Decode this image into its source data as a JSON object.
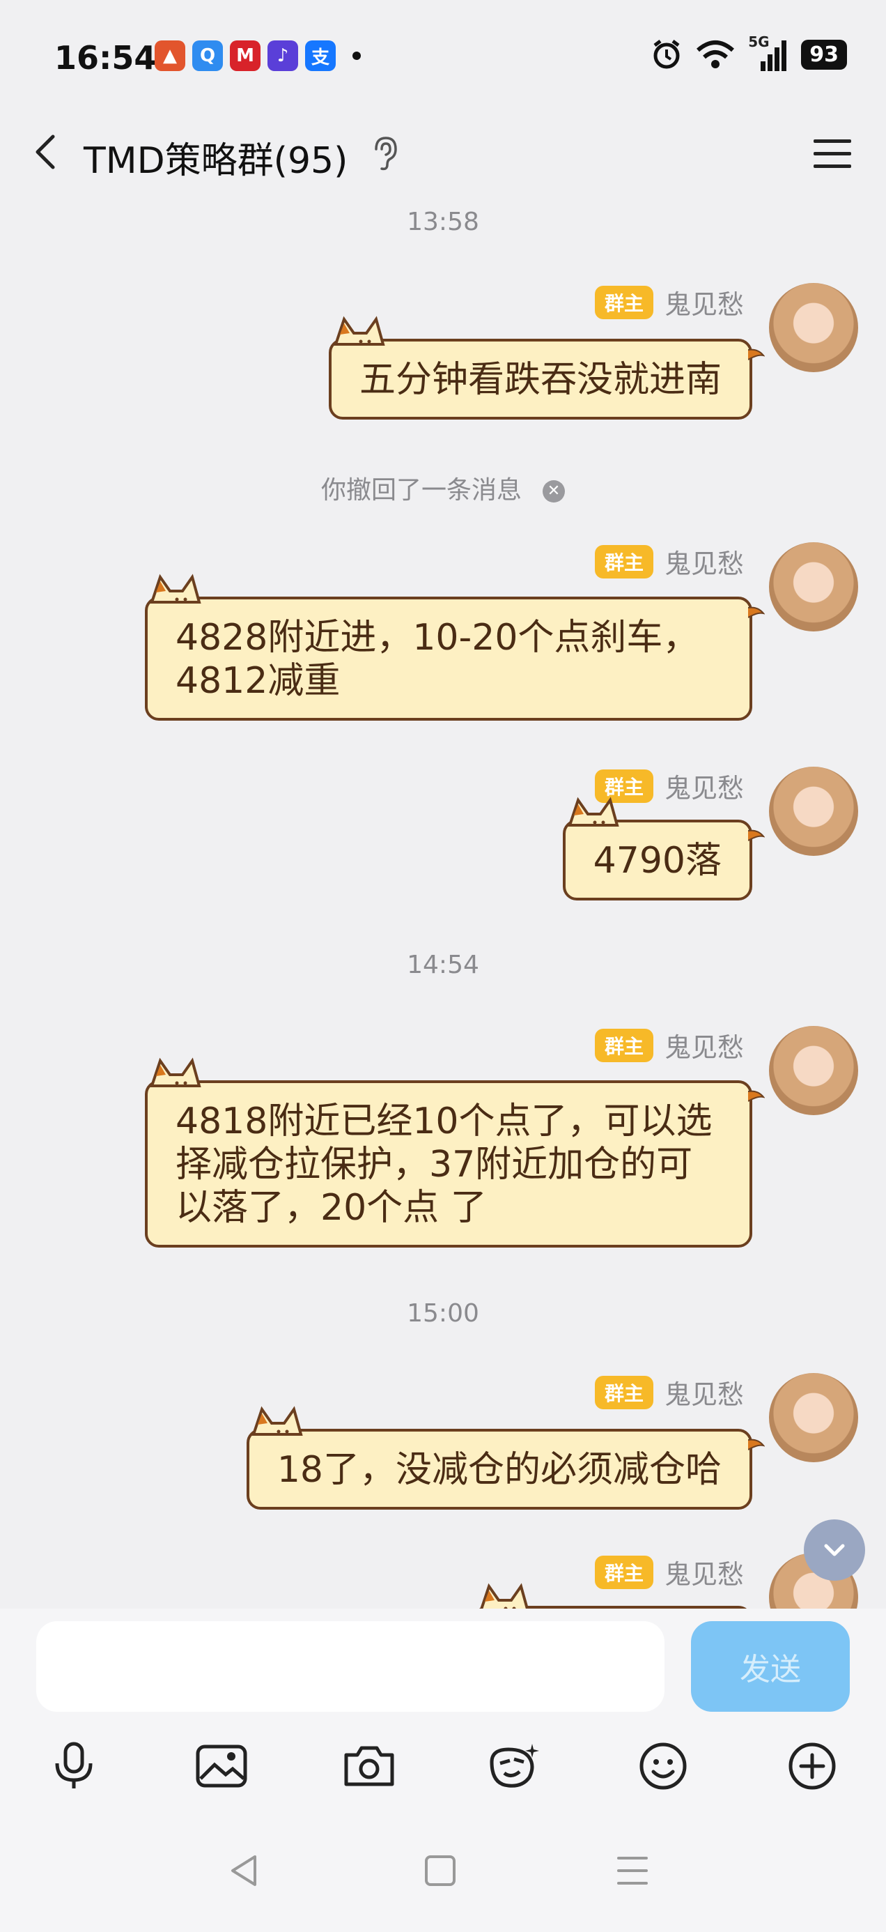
{
  "status_bar": {
    "time": "16:54",
    "app_icons": [
      {
        "name": "meituan-app-icon",
        "color": "#e2552d",
        "glyph": "🎪"
      },
      {
        "name": "qq-browser-app-icon",
        "color": "#2f8cf0",
        "glyph": "Q"
      },
      {
        "name": "cmb-bank-app-icon",
        "color": "#d8232a",
        "glyph": "M"
      },
      {
        "name": "ai-app-icon",
        "color": "#5a3fd8",
        "glyph": "⌘"
      },
      {
        "name": "alipay-app-icon",
        "color": "#1677ff",
        "glyph": "支"
      }
    ],
    "network": "5G",
    "battery": "93"
  },
  "header": {
    "title": "TMD策略群(95)"
  },
  "chat": {
    "timestamps": [
      "13:58",
      "14:54",
      "15:00"
    ],
    "recall_notice": "你撤回了一条消息",
    "messages": [
      {
        "badge": "群主",
        "sender": "鬼见愁",
        "text": "五分钟看跌吞没就进南"
      },
      {
        "badge": "群主",
        "sender": "鬼见愁",
        "text": "4828附近进，10-20个点刹车，4812减重"
      },
      {
        "badge": "群主",
        "sender": "鬼见愁",
        "text": "4790落"
      },
      {
        "badge": "群主",
        "sender": "鬼见愁",
        "text": "4818附近已经10个点了，可以选择减仓拉保护，37附近加仓的可以落了，20个点 了"
      },
      {
        "badge": "群主",
        "sender": "鬼见愁",
        "text": "18了，没减仓的必须减仓哈"
      },
      {
        "badge": "群主",
        "sender": "鬼见愁",
        "text": ""
      }
    ]
  },
  "input": {
    "value": "",
    "send_label": "发送"
  },
  "colors": {
    "bubble_fill": "#fdf0c3",
    "bubble_border": "#6b3f1f",
    "badge": "#f7b928",
    "send_button": "#7dc5f5"
  },
  "toolbar_icons": [
    "microphone-icon",
    "image-icon",
    "camera-icon",
    "sticker-icon",
    "emoji-icon",
    "plus-icon"
  ]
}
